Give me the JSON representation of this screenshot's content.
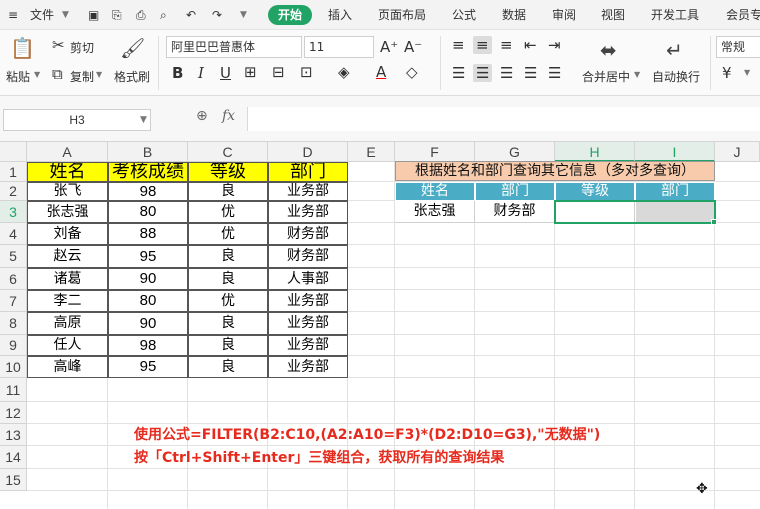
{
  "menubar": {
    "file_menu": "文件",
    "tabs": [
      "开始",
      "插入",
      "页面布局",
      "公式",
      "数据",
      "审阅",
      "视图",
      "开发工具",
      "会员专"
    ]
  },
  "ribbon": {
    "paste": "粘贴",
    "cut": "剪切",
    "copy": "复制",
    "format_painter": "格式刷",
    "font_name": "阿里巴巴普惠体",
    "font_size": "11",
    "merge_center": "合并居中",
    "wrap_text": "自动换行",
    "number_format": "常规",
    "currency_symbol": "¥"
  },
  "formula_bar": {
    "name_box": "H3",
    "fx": "fx",
    "formula": ""
  },
  "columns": [
    "A",
    "B",
    "C",
    "D",
    "E",
    "F",
    "G",
    "H",
    "I",
    "J"
  ],
  "active_columns": [
    "H",
    "I"
  ],
  "rows": [
    "1",
    "2",
    "3",
    "4",
    "5",
    "6",
    "7",
    "8",
    "9",
    "10",
    "11",
    "12",
    "13",
    "14",
    "15"
  ],
  "active_row": "3",
  "table": {
    "headers": [
      "姓名",
      "考核成绩",
      "等级",
      "部门"
    ],
    "rows": [
      [
        "张飞",
        "98",
        "良",
        "业务部"
      ],
      [
        "张志强",
        "80",
        "优",
        "业务部"
      ],
      [
        "刘备",
        "88",
        "优",
        "财务部"
      ],
      [
        "赵云",
        "95",
        "良",
        "财务部"
      ],
      [
        "诸葛",
        "90",
        "良",
        "人事部"
      ],
      [
        "李二",
        "80",
        "优",
        "业务部"
      ],
      [
        "高原",
        "90",
        "良",
        "业务部"
      ],
      [
        "任人",
        "98",
        "良",
        "业务部"
      ],
      [
        "高峰",
        "95",
        "良",
        "业务部"
      ]
    ]
  },
  "query": {
    "title": "根据姓名和部门查询其它信息（多对多查询）",
    "headers": [
      "姓名",
      "部门",
      "等级",
      "部门"
    ],
    "values": [
      "张志强",
      "财务部",
      "",
      ""
    ]
  },
  "notes": {
    "line1": "使用公式=FILTER(B2:C10,(A2:A10=F3)*(D2:D10=G3),\"无数据\")",
    "line2": "按「Ctrl+Shift+Enter」三键组合，获取所有的查询结果"
  },
  "colors": {
    "accent": "#21a366",
    "header_yellow": "#ffff00",
    "query_title_bg": "#f8cbad",
    "query_header_bg": "#4bacc6",
    "note_red": "#e62b1e"
  }
}
